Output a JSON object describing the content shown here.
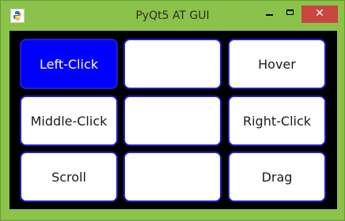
{
  "window": {
    "title": "PyQt5 AT GUI",
    "icon": "python-icon",
    "controls": {
      "minimize_icon": "minimize-icon",
      "maximize_icon": "maximize-icon",
      "close_glyph": "✕"
    }
  },
  "buttons": [
    {
      "label": "Left-Click",
      "active": true
    },
    {
      "label": ""
    },
    {
      "label": "Hover"
    },
    {
      "label": "Middle-Click"
    },
    {
      "label": ""
    },
    {
      "label": "Right-Click"
    },
    {
      "label": "Scroll"
    },
    {
      "label": ""
    },
    {
      "label": "Drag"
    }
  ],
  "colors": {
    "frame": "#8bc34a",
    "client_background": "#000000",
    "button_border": "#2020c8",
    "active_button": "#0000ff",
    "close_button": "#c7463e"
  }
}
